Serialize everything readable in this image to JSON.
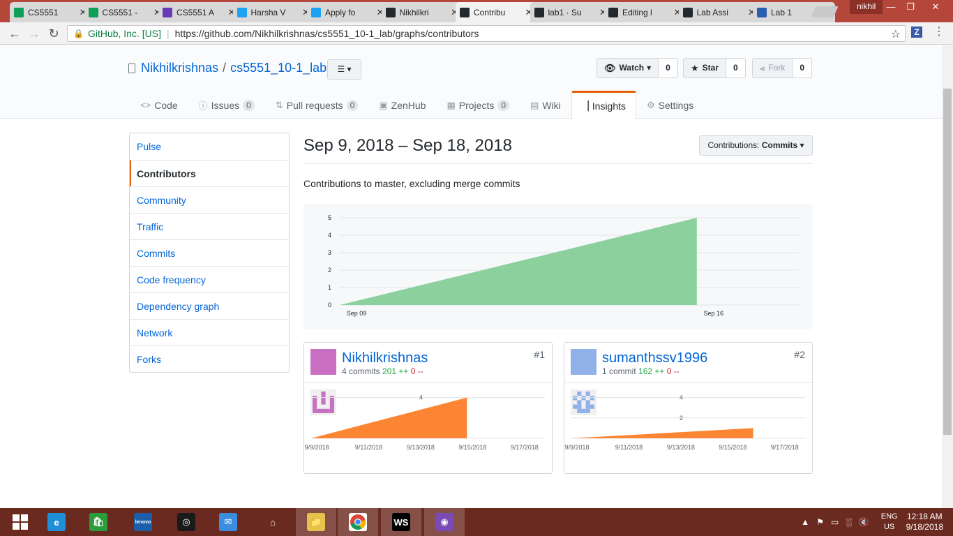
{
  "browser": {
    "tabs": [
      {
        "title": "CS5551",
        "icon": "sheets-icon",
        "color": "#0f9d58"
      },
      {
        "title": "CS5551 - ",
        "icon": "sheets-icon",
        "color": "#0f9d58"
      },
      {
        "title": "CS5551 A",
        "icon": "forms-icon",
        "color": "#673ab7"
      },
      {
        "title": "Harsha V",
        "icon": "twitter-icon",
        "color": "#1da1f2"
      },
      {
        "title": "Apply fo",
        "icon": "twitter-icon",
        "color": "#1da1f2"
      },
      {
        "title": "Nikhilkri",
        "icon": "github-icon",
        "color": "#24292e"
      },
      {
        "title": "Contribu",
        "icon": "github-icon",
        "color": "#24292e",
        "active": true
      },
      {
        "title": "lab1 · Su",
        "icon": "github-icon",
        "color": "#24292e"
      },
      {
        "title": "Editing l",
        "icon": "github-icon",
        "color": "#24292e"
      },
      {
        "title": "Lab Assi",
        "icon": "github-icon",
        "color": "#24292e"
      },
      {
        "title": "Lab 1",
        "icon": "umkc-icon",
        "color": "#2a5fb0"
      }
    ],
    "user": "nikhil",
    "address": {
      "org": "GitHub, Inc. [US]",
      "url": "https://github.com/Nikhilkrishnas/cs5551_10-1_lab/graphs/contributors"
    },
    "extension_label": "Z"
  },
  "repo": {
    "owner": "Nikhilkrishnas",
    "name": "cs5551_10-1_lab",
    "watch": {
      "label": "Watch",
      "count": "0"
    },
    "star": {
      "label": "Star",
      "count": "0"
    },
    "fork": {
      "label": "Fork",
      "count": "0"
    },
    "nav": [
      {
        "label": "Code",
        "icon": "code-icon"
      },
      {
        "label": "Issues",
        "icon": "issue-icon",
        "count": "0"
      },
      {
        "label": "Pull requests",
        "icon": "pull-request-icon",
        "count": "0"
      },
      {
        "label": "ZenHub",
        "icon": "zenhub-icon"
      },
      {
        "label": "Projects",
        "icon": "project-icon",
        "count": "0"
      },
      {
        "label": "Wiki",
        "icon": "book-icon"
      },
      {
        "label": "Insights",
        "icon": "graph-icon",
        "selected": true
      },
      {
        "label": "Settings",
        "icon": "gear-icon"
      }
    ]
  },
  "sidebar": {
    "items": [
      {
        "label": "Pulse"
      },
      {
        "label": "Contributors",
        "selected": true
      },
      {
        "label": "Community"
      },
      {
        "label": "Traffic"
      },
      {
        "label": "Commits"
      },
      {
        "label": "Code frequency"
      },
      {
        "label": "Dependency graph"
      },
      {
        "label": "Network"
      },
      {
        "label": "Forks"
      }
    ]
  },
  "main": {
    "date_range": "Sep 9, 2018 – Sep 18, 2018",
    "contrib_selector": {
      "prefix": "Contributions:",
      "value": "Commits"
    },
    "subtitle": "Contributions to master, excluding merge commits"
  },
  "chart_data": [
    {
      "type": "area",
      "title": "",
      "x": [
        "2018-09-09",
        "2018-09-16"
      ],
      "values": [
        0,
        5
      ],
      "x_ticks": [
        "Sep 09",
        "Sep 16"
      ],
      "y_ticks": [
        "0",
        "1",
        "2",
        "3",
        "4",
        "5"
      ],
      "ylim": [
        0,
        5
      ],
      "color": "#8cd19d",
      "grid": true
    },
    {
      "type": "area",
      "title": "Nikhilkrishnas",
      "x": [
        "9/9/2018",
        "9/15/2018"
      ],
      "values": [
        0,
        4
      ],
      "x_ticks": [
        "9/9/2018",
        "9/11/2018",
        "9/13/2018",
        "9/15/2018",
        "9/17/2018"
      ],
      "y_ticks": [
        "4"
      ],
      "ylim": [
        0,
        5
      ],
      "color": "#fb8532",
      "grid": true
    },
    {
      "type": "area",
      "title": "sumanthssv1996",
      "x": [
        "9/9/2018",
        "9/16/2018"
      ],
      "values": [
        0,
        1
      ],
      "x_ticks": [
        "9/9/2018",
        "9/11/2018",
        "9/13/2018",
        "9/15/2018",
        "9/17/2018"
      ],
      "y_ticks": [
        "2",
        "4"
      ],
      "ylim": [
        0,
        5
      ],
      "color": "#fb8532",
      "grid": true
    }
  ],
  "contributors": [
    {
      "rank": "#1",
      "name": "Nikhilkrishnas",
      "commits": "4 commits",
      "additions": "201 ++",
      "deletions": "0 --",
      "avatar_color": "#c86fc1"
    },
    {
      "rank": "#2",
      "name": "sumanthssv1996",
      "commits": "1 commit",
      "additions": "162 ++",
      "deletions": "0 --",
      "avatar_color": "#8fb0e8"
    }
  ],
  "taskbar": {
    "apps": [
      {
        "name": "start-icon"
      },
      {
        "name": "ie-icon",
        "label": "e"
      },
      {
        "name": "store-icon"
      },
      {
        "name": "lenovo-icon",
        "label": "lenovo"
      },
      {
        "name": "app-circle-icon"
      },
      {
        "name": "mail-icon"
      },
      {
        "name": "home-icon"
      },
      {
        "name": "file-explorer-icon",
        "open": true
      },
      {
        "name": "chrome-icon",
        "open": true
      },
      {
        "name": "webstorm-icon",
        "label": "WS",
        "open": true
      },
      {
        "name": "github-desktop-icon",
        "open": true
      }
    ],
    "lang": "ENG",
    "region": "US",
    "time": "12:18 AM",
    "date": "9/18/2018"
  }
}
